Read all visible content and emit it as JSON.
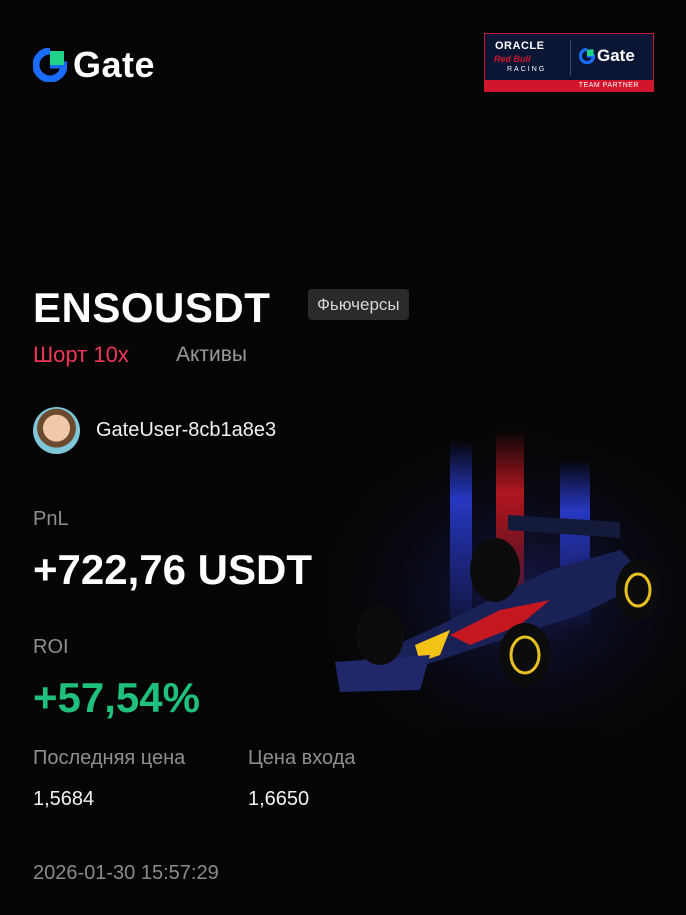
{
  "brand": {
    "name": "Gate"
  },
  "partner_badge": {
    "line1": "ORACLE",
    "line2": "Red Bull",
    "line3": "RACING",
    "brand": "Gate",
    "strip": "TEAM PARTNER"
  },
  "position": {
    "symbol": "ENSOUSDT",
    "market_tag": "Фьючерсы",
    "side": "Шорт 10x",
    "asset_label": "Активы"
  },
  "user": {
    "name": "GateUser-8cb1a8e3"
  },
  "pnl": {
    "label": "PnL",
    "value": "+722,76 USDT"
  },
  "roi": {
    "label": "ROI",
    "value": "+57,54%"
  },
  "prices": {
    "last_label": "Последняя цена",
    "last_value": "1,5684",
    "entry_label": "Цена входа",
    "entry_value": "1,6650"
  },
  "timestamp": "2026-01-30 15:57:29",
  "colors": {
    "short": "#f0375a",
    "positive": "#1fc07c",
    "brand_blue": "#1b6bff",
    "brand_green": "#1fd38a"
  }
}
